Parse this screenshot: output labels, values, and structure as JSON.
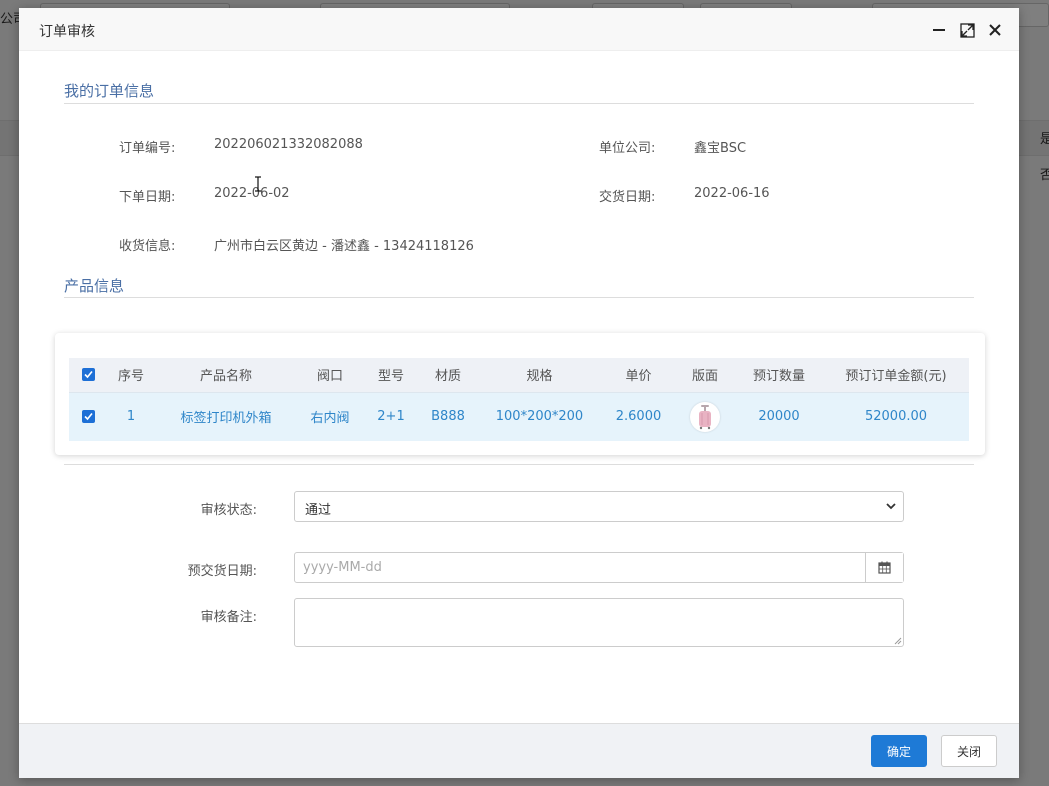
{
  "background": {
    "left_text": "公司",
    "right_texts": [
      "是",
      "否"
    ]
  },
  "modal": {
    "title": "订单审核"
  },
  "order_section": {
    "title": "我的订单信息",
    "order_no_label": "订单编号:",
    "order_no": "202206021332082088",
    "company_label": "单位公司:",
    "company": "鑫宝BSC",
    "order_date_label": "下单日期:",
    "order_date": "2022-06-02",
    "delivery_date_label": "交货日期:",
    "delivery_date": "2022-06-16",
    "shipping_label": "收货信息:",
    "shipping": "广州市白云区黄边 - 潘述鑫 - 13424118126"
  },
  "product_section": {
    "title": "产品信息",
    "columns": [
      "序号",
      "产品名称",
      "阀口",
      "型号",
      "材质",
      "规格",
      "单价",
      "版面",
      "预订数量",
      "预订订单金额(元)"
    ],
    "rows": [
      {
        "index": "1",
        "name": "标签打印机外箱",
        "valve": "右内阀",
        "model": "2+1",
        "material": "B888",
        "spec": "100*200*200",
        "price": "2.6000",
        "image_icon": "luggage-thumbnail",
        "qty": "20000",
        "amount": "52000.00"
      }
    ]
  },
  "review_form": {
    "status_label": "审核状态:",
    "status_value": "通过",
    "pre_delivery_label": "预交货日期:",
    "pre_delivery_placeholder": "yyyy-MM-dd",
    "remark_label": "审核备注:"
  },
  "footer": {
    "confirm_label": "确定",
    "close_label": "关闭"
  },
  "colors": {
    "accent": "#1e7ad6",
    "section_title": "#4a6fa5",
    "table_link": "#2f86c9",
    "row_highlight": "#e6f3fb"
  }
}
